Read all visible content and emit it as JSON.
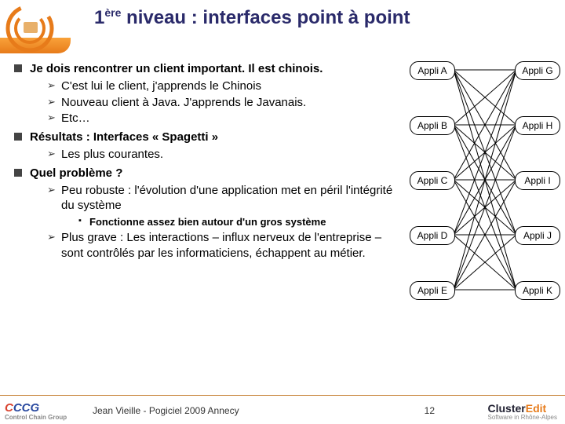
{
  "title_prefix": "1",
  "title_sup": "ère",
  "title_rest": " niveau : interfaces point à point",
  "bullets": {
    "b1": "Je dois rencontrer un client important. Il est chinois.",
    "b1_s1": "C'est lui le client, j'apprends le Chinois",
    "b1_s2": "Nouveau client à Java. J'apprends le Javanais.",
    "b1_s3": "Etc…",
    "b2": "Résultats : Interfaces « Spagetti »",
    "b2_s1": "Les plus courantes.",
    "b3": "Quel problème ?",
    "b3_s1": "Peu robuste : l'évolution d'une application met en péril l'intégrité du système",
    "b3_s1_sq": "Fonctionne assez bien autour d'un gros système",
    "b3_s2": "Plus grave : Les interactions – influx nerveux de l'entreprise – sont contrôlés par les informaticiens, échappent au métier."
  },
  "nodes": {
    "left": [
      "Appli A",
      "Appli B",
      "Appli C",
      "Appli D",
      "Appli E"
    ],
    "right": [
      "Appli G",
      "Appli H",
      "Appli I",
      "Appli J",
      "Appli K"
    ]
  },
  "footer": {
    "ccg": "CCG",
    "ccg_full": "Control Chain Group",
    "mid": "Jean Vieille - Pogiciel 2009 Annecy",
    "page": "12",
    "ce_cluster": "Cluster",
    "ce_edit": "Edit",
    "ce_sub": "Software in Rhône-Alpes"
  }
}
